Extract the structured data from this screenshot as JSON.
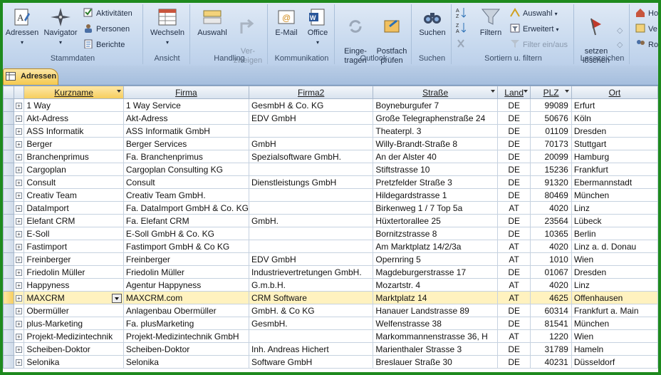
{
  "ribbon": {
    "groups": [
      {
        "label": "Stammdaten",
        "buttons": [
          "Adressen",
          "Navigator"
        ],
        "small": [
          "Aktivitäten",
          "Personen",
          "Berichte"
        ]
      },
      {
        "label": "Ansicht",
        "buttons": [
          "Wechseln"
        ]
      },
      {
        "label": "Handling",
        "buttons": [
          "Auswahl",
          "Ver-\nzweigen"
        ]
      },
      {
        "label": "Kommunikation",
        "buttons": [
          "E-Mail",
          "Office"
        ]
      },
      {
        "label": "Outlook",
        "buttons": [
          "Einge-\ntragen",
          "Postfach\nprüfen"
        ]
      },
      {
        "label": "Suchen",
        "buttons": [
          "Suchen"
        ]
      },
      {
        "label": "Sortiern u. filtern",
        "buttons": [
          "Filtern"
        ],
        "small": [
          "Auswahl",
          "Erweitert",
          "Filter ein/aus"
        ]
      },
      {
        "label": "Lesezeichen",
        "buttons": [
          "setzen\nlöschen"
        ]
      }
    ],
    "right_items": [
      "Ho",
      "Ve",
      "Ro"
    ]
  },
  "tab": {
    "label": "Adressen"
  },
  "table": {
    "columns": [
      "Kurzname",
      "Firma",
      "Firma2",
      "Straße",
      "Land",
      "PLZ",
      "Ort"
    ],
    "rows": [
      [
        "1 Way",
        "1 Way Service",
        "GesmbH & Co. KG",
        "Boyneburgufer 7",
        "DE",
        "99089",
        "Erfurt"
      ],
      [
        "Akt-Adress",
        "Akt-Adress",
        "EDV GmbH",
        "Große Telegraphenstraße 24",
        "DE",
        "50676",
        "Köln"
      ],
      [
        "ASS Informatik",
        "ASS Informatik GmbH",
        "",
        "Theaterpl. 3",
        "DE",
        "01109",
        "Dresden"
      ],
      [
        "Berger",
        "Berger Services",
        "GmbH",
        "Willy-Brandt-Straße 8",
        "DE",
        "70173",
        "Stuttgart"
      ],
      [
        "Branchenprimus",
        "Fa. Branchenprimus",
        "Spezialsoftware GmbH.",
        "An der Alster 40",
        "DE",
        "20099",
        "Hamburg"
      ],
      [
        "Cargoplan",
        "Cargoplan Consulting KG",
        "",
        "Stiftstrasse 10",
        "DE",
        "15236",
        "Frankfurt"
      ],
      [
        "Consult",
        "Consult",
        "Dienstleistungs GmbH",
        "Pretzfelder Straße 3",
        "DE",
        "91320",
        "Ebermannstadt"
      ],
      [
        "Creativ Team",
        "Creativ Team GmbH.",
        "",
        "Hildegardstrasse 1",
        "DE",
        "80469",
        "München"
      ],
      [
        "DataImport",
        "Fa. DataImport GmbH & Co. KG",
        "",
        "Birkenweg 1 / 7 Top 5a",
        "AT",
        "4020",
        "Linz"
      ],
      [
        "Elefant CRM",
        "Fa. Elefant CRM",
        "GmbH.",
        "Hüxtertorallee 25",
        "DE",
        "23564",
        "Lübeck"
      ],
      [
        "E-Soll",
        "E-Soll GmbH & Co. KG",
        "",
        "Bornitzstrasse 8",
        "DE",
        "10365",
        "Berlin"
      ],
      [
        "Fastimport",
        "Fastimport GmbH & Co KG",
        "",
        "Am Marktplatz 14/2/3a",
        "AT",
        "4020",
        "Linz a. d. Donau"
      ],
      [
        "Freinberger",
        "Freinberger",
        "EDV GmbH",
        "Opernring 5",
        "AT",
        "1010",
        "Wien"
      ],
      [
        "Friedolin Müller",
        "Friedolin Müller",
        "Industrievertretungen GmbH.",
        "Magdeburgerstrasse 17",
        "DE",
        "01067",
        "Dresden"
      ],
      [
        "Happyness",
        "Agentur Happyness",
        "G.m.b.H.",
        "Mozartstr. 4",
        "AT",
        "4020",
        "Linz"
      ],
      [
        "MAXCRM",
        "MAXCRM.com",
        "CRM Software",
        "Marktplatz 14",
        "AT",
        "4625",
        "Offenhausen"
      ],
      [
        "Obermüller",
        "Anlagenbau Obermüller",
        "GmbH. & Co KG",
        "Hanauer Landstrasse 89",
        "DE",
        "60314",
        "Frankfurt a. Main"
      ],
      [
        "plus-Marketing",
        "Fa. plusMarketing",
        "GesmbH.",
        "Welfenstrasse 38",
        "DE",
        "81541",
        "München"
      ],
      [
        "Projekt-Medizintechnik",
        "Projekt-Medizintechnik GmbH",
        "",
        "Markommannenstrasse 36, H",
        "AT",
        "1220",
        "Wien"
      ],
      [
        "Scheiben-Doktor",
        "Scheiben-Doktor",
        "Inh. Andreas Hichert",
        "Marienthaler Strasse 3",
        "DE",
        "31789",
        "Hameln"
      ],
      [
        "Selonika",
        "Selonika",
        "Software GmbH",
        "Breslauer Straße 30",
        "DE",
        "40231",
        "Düsseldorf"
      ]
    ],
    "current_row_index": 15
  }
}
